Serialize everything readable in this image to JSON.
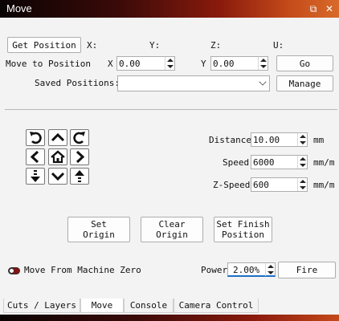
{
  "window": {
    "title": "Move",
    "restore_glyph": "⧉",
    "close_glyph": "✕"
  },
  "position": {
    "get_position_label": "Get Position",
    "x_label": "X:",
    "y_label": "Y:",
    "z_label": "Z:",
    "u_label": "U:"
  },
  "move_to": {
    "label": "Move to Position",
    "x_axis": "X",
    "x_value": "0.00",
    "y_axis": "Y",
    "y_value": "0.00",
    "go_label": "Go"
  },
  "saved": {
    "label": "Saved Positions:",
    "value": "",
    "manage_label": "Manage"
  },
  "jog_controls": {
    "distance_label": "Distance",
    "distance_value": "10.00",
    "distance_unit": "mm",
    "speed_label": "Speed",
    "speed_value": "6000",
    "speed_unit": "mm/m",
    "zspeed_label": "Z-Speed",
    "zspeed_value": "600",
    "zspeed_unit": "mm/m"
  },
  "origin_buttons": {
    "set_origin": [
      "Set",
      "Origin"
    ],
    "clear_origin": [
      "Clear",
      "Origin"
    ],
    "set_finish": [
      "Set Finish",
      "Position"
    ]
  },
  "fire_row": {
    "machine_zero_label": "Move From Machine Zero",
    "power_label": "Power",
    "power_value": "2.00%",
    "fire_label": "Fire"
  },
  "tabs": [
    {
      "label": "Cuts / Layers",
      "active": false
    },
    {
      "label": "Move",
      "active": true
    },
    {
      "label": "Console",
      "active": false
    },
    {
      "label": "Camera Control",
      "active": false
    }
  ]
}
